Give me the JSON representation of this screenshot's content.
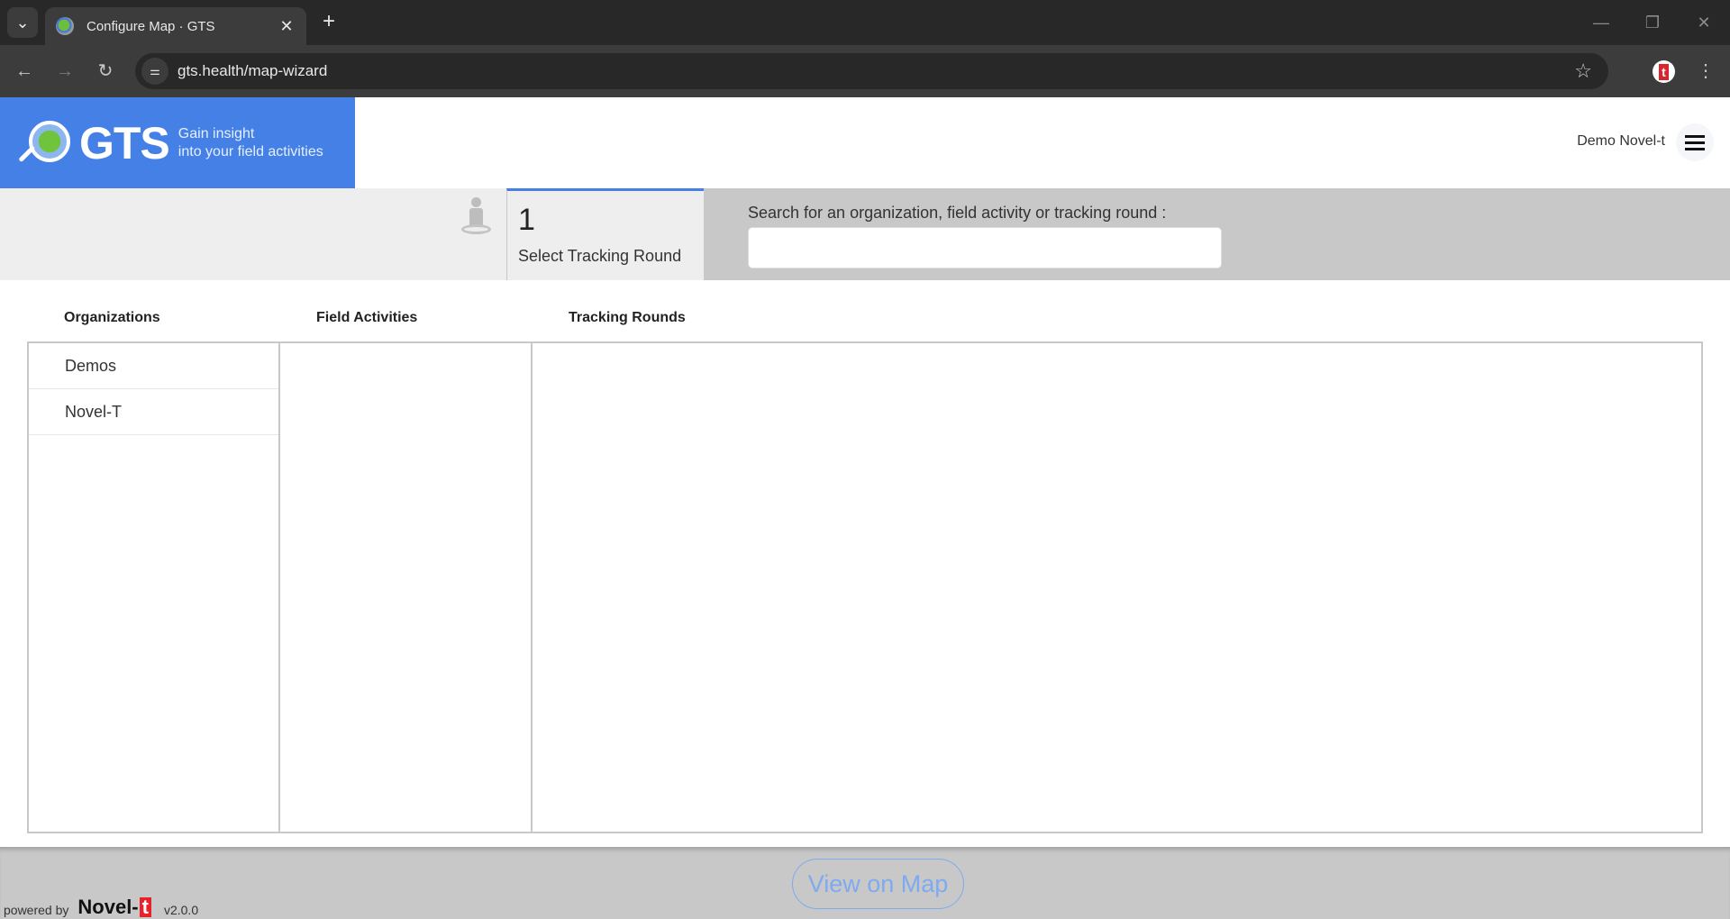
{
  "browser": {
    "tab_title": "Configure Map · GTS",
    "url": "gts.health/map-wizard",
    "icons": {
      "tab_search": "chevron-down-icon",
      "tab_close": "close-icon",
      "new_tab": "plus-icon",
      "back": "arrow-left-icon",
      "forward": "arrow-right-icon",
      "reload": "reload-icon",
      "site_info": "tune-icon",
      "bookmark": "star-icon",
      "extension": "novel-t-extension-icon",
      "menu": "kebab-menu-icon",
      "minimize": "minimize-icon",
      "maximize": "restore-icon",
      "close_window": "close-icon"
    },
    "glyphs": {
      "tab_search": "⌄",
      "tab_close": "✕",
      "new_tab": "+",
      "back": "←",
      "forward": "→",
      "reload": "↻",
      "site_info": "⚌",
      "bookmark": "☆",
      "extension": "t",
      "menu": "⋮",
      "minimize": "—",
      "maximize": "❐",
      "close_window": "✕"
    }
  },
  "header": {
    "brand_name": "GTS",
    "tagline_line1": "Gain insight",
    "tagline_line2": "into your field activities",
    "user_name": "Demo Novel-t",
    "brand_color": "#4580e6"
  },
  "wizard": {
    "step_number": "1",
    "step_label": "Select Tracking Round",
    "search_label": "Search for an organization, field activity or tracking round :",
    "search_value": "",
    "search_placeholder": ""
  },
  "columns": {
    "organizations_header": "Organizations",
    "field_activities_header": "Field Activities",
    "tracking_rounds_header": "Tracking Rounds",
    "organizations": [
      "Demos",
      "Novel-T"
    ],
    "field_activities": [],
    "tracking_rounds": []
  },
  "footer": {
    "view_on_map_label": "View on Map",
    "powered_by": "powered by",
    "company_prefix": "Novel-",
    "company_suffix": "t",
    "version": "v2.0.0"
  }
}
